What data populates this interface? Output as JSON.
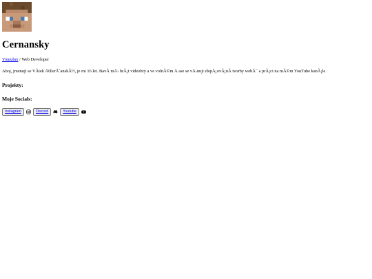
{
  "profile": {
    "name": "Cernansky",
    "role_link": "Youtuber",
    "role_separator": " / ",
    "role_rest": "Web Developer",
    "bio": "Ahoj, jmenuji se VÃ­tek ÄŒerÅˆanskÃ½, je mi 16 let. BavÃ­ mÄ› hrÃ¡t videohry a ve volnÃ©m Ä     ase se vÄ›nuji zlepÅ¡ovÃ¡nÃ­ tvorby webÅ¯ a prÃ¡ci na mÃ©m YouTube kanÃ¡le."
  },
  "sections": {
    "projects_title": "Projekty:",
    "socials_title": "Moje Socials:"
  },
  "socials": [
    {
      "label": "Instagram",
      "icon": "instagram-icon"
    },
    {
      "label": "Discord",
      "icon": "discord-icon"
    },
    {
      "label": "Youtube",
      "icon": "youtube-icon"
    }
  ],
  "colors": {
    "link": "#0000ee",
    "button_bg": "#efefef",
    "button_border": "#767676"
  }
}
